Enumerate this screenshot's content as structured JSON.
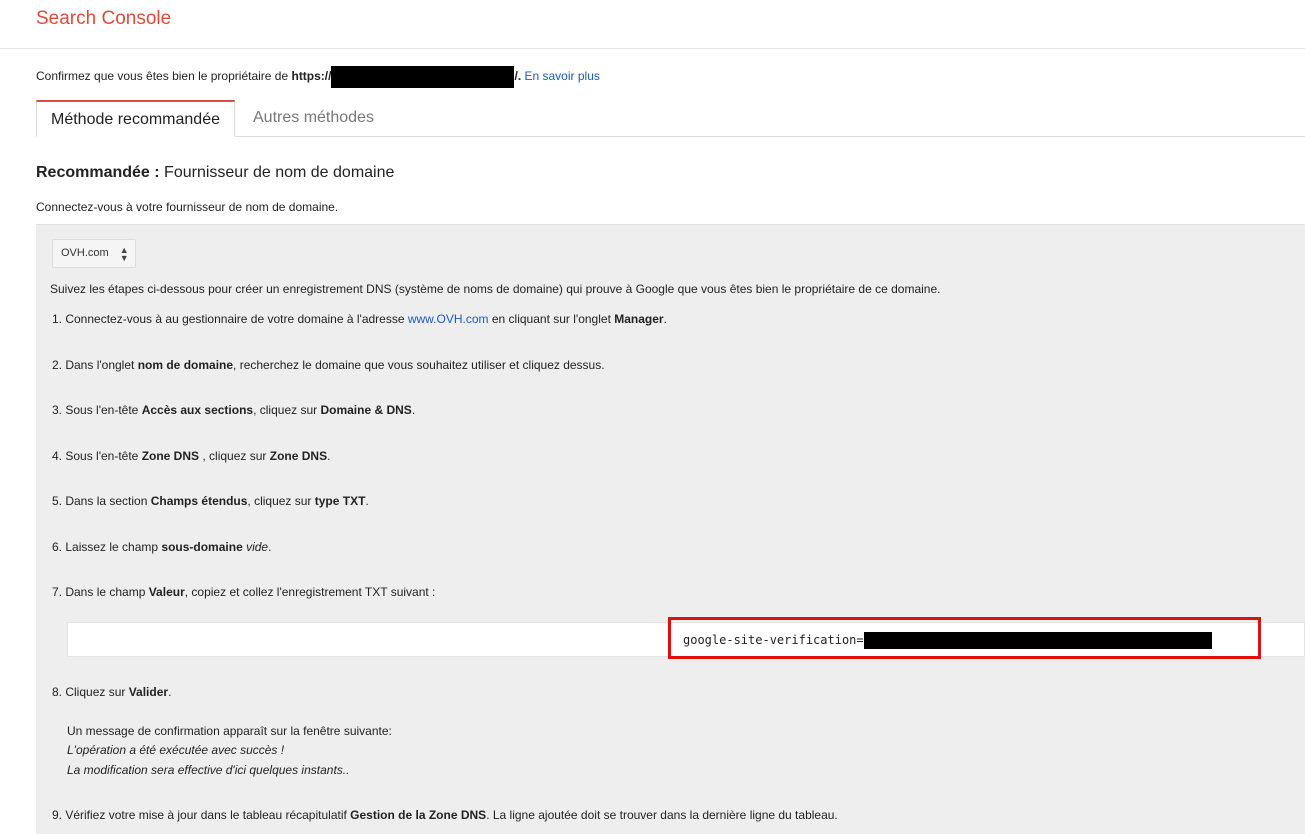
{
  "app": {
    "title": "Search Console"
  },
  "confirm": {
    "prefix": "Confirmez que vous êtes bien le propriétaire de ",
    "url_start": "https://",
    "url_end": "/.",
    "learn_more": "En savoir plus"
  },
  "tabs": [
    {
      "label": "Méthode recommandée",
      "active": true
    },
    {
      "label": "Autres méthodes",
      "active": false
    }
  ],
  "recommended": {
    "label": "Recommandée :",
    "provider_heading": "Fournisseur de nom de domaine",
    "subtitle": "Connectez-vous à votre fournisseur de nom de domaine."
  },
  "provider_select": {
    "selected": "OVH.com"
  },
  "intro": "Suivez les étapes ci-dessous pour créer un enregistrement DNS (système de noms de domaine) qui prouve à Google que vous êtes bien le propriétaire de ce domaine.",
  "steps": {
    "s1": {
      "a": "1. Connectez-vous à au gestionnaire de votre domaine à l'adresse ",
      "link": "www.OVH.com",
      "b": " en cliquant sur l'onglet ",
      "bold": "Manager",
      "c": "."
    },
    "s2": {
      "a": "2. Dans l'onglet ",
      "bold": "nom de domaine",
      "b": ", recherchez le domaine que vous souhaitez utiliser et cliquez dessus."
    },
    "s3": {
      "a": "3. Sous l'en-tête ",
      "bold1": "Accès aux sections",
      "b": ", cliquez sur ",
      "bold2": "Domaine & DNS",
      "c": "."
    },
    "s4": {
      "a": "4. Sous l'en-tête ",
      "bold1": "Zone DNS",
      "b": " , cliquez sur ",
      "bold2": "Zone DNS",
      "c": "."
    },
    "s5": {
      "a": "5. Dans la section ",
      "bold1": "Champs étendus",
      "b": ", cliquez sur ",
      "bold2": "type TXT",
      "c": "."
    },
    "s6": {
      "a": "6. Laissez le champ ",
      "bold": "sous-domaine",
      "italic": " vide",
      "c": "."
    },
    "s7": {
      "a": "7. Dans le champ ",
      "bold": "Valeur",
      "b": ", copiez et collez l'enregistrement TXT suivant :"
    },
    "s8": {
      "a": "8. Cliquez sur ",
      "bold": "Valider",
      "c": "."
    },
    "s9": {
      "a": "9. Vérifiez votre mise à jour dans le tableau récapitulatif ",
      "bold": "Gestion de la Zone DNS",
      "b": ". La ligne ajoutée doit se trouver dans la dernière ligne du tableau."
    }
  },
  "txt_record": {
    "prefix": "google-site-verification="
  },
  "confirmation": {
    "line1": "Un message de confirmation apparaît sur la fenêtre suivante:",
    "line2": "L'opération a été exécutée avec succès !",
    "line3": "La modification sera effective d'ici quelques instants.."
  },
  "colors": {
    "brand": "#dd4b39",
    "link": "#1a5bb5",
    "highlight": "#e01010",
    "panel": "#eeeeee"
  }
}
